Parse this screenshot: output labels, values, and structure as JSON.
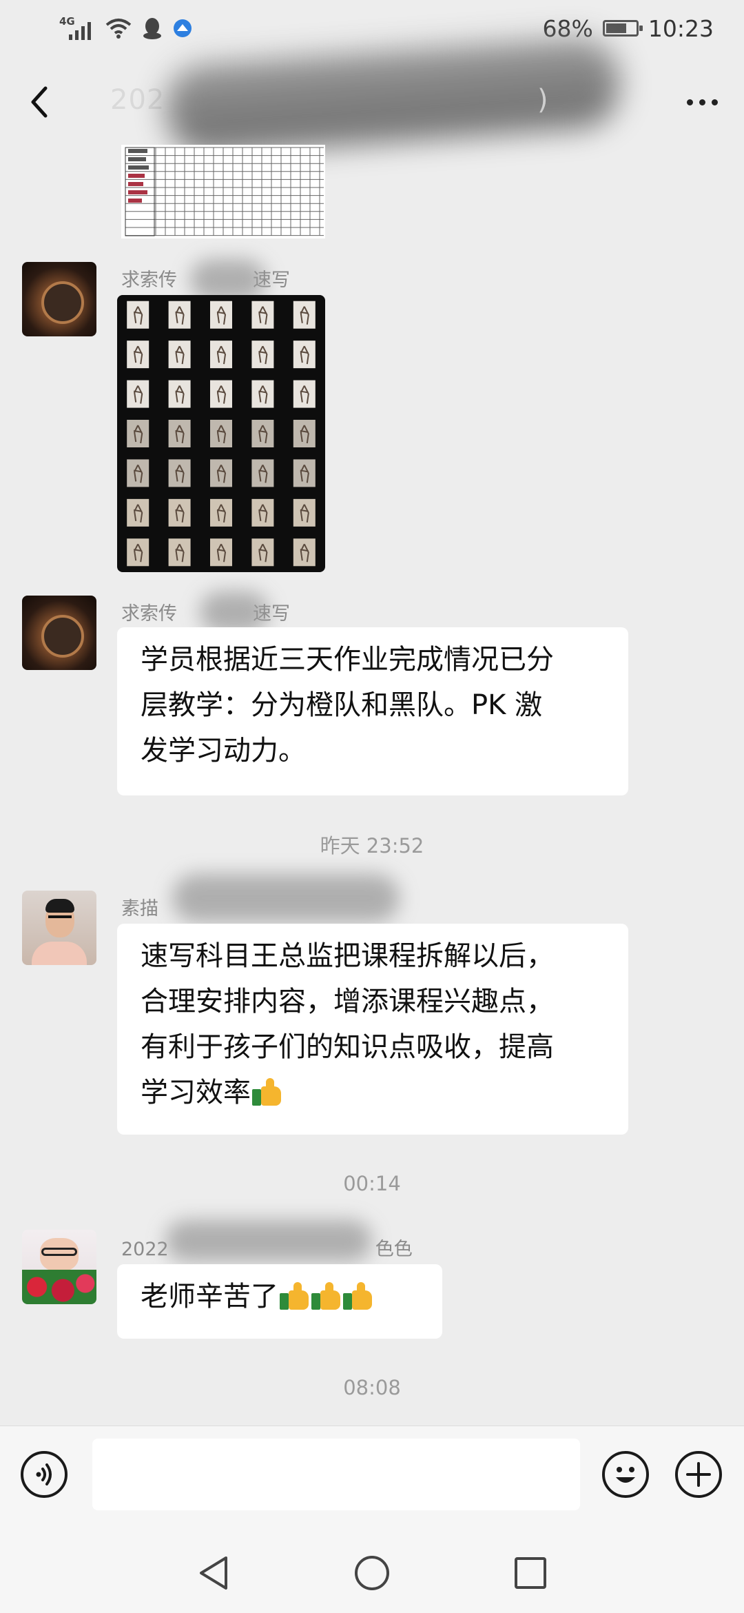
{
  "status_bar": {
    "network": "4G",
    "battery_percent": "68%",
    "battery_level": 0.68,
    "time": "10:23"
  },
  "header": {
    "title_prefix": "202",
    "title_suffix": ")",
    "back_icon": "back-arrow-icon",
    "more_icon": "more-dots-icon"
  },
  "messages": [
    {
      "sender": "求索传",
      "sender_suffix": "速写",
      "type": "image"
    },
    {
      "sender": "求索传",
      "sender_suffix": "速写",
      "type": "text",
      "lines": [
        "学员根据近三天作业完成情况已分",
        "层教学：分为橙队和黑队。PK 激",
        "发学习动力。"
      ]
    },
    {
      "sender": "素描",
      "type": "text",
      "lines": [
        "速写科目王总监把课程拆解以后，",
        "合理安排内容，增添课程兴趣点，",
        "有利于孩子们的知识点吸收，提高",
        "学习效率"
      ]
    },
    {
      "sender": "2022",
      "sender_suffix": "色色",
      "type": "text",
      "text": "老师辛苦了"
    }
  ],
  "timestamps": [
    "昨天 23:52",
    "00:14",
    "08:08"
  ],
  "input_bar": {
    "voice_icon": "voice-icon",
    "emoji_icon": "emoji-icon",
    "plus_icon": "plus-icon"
  },
  "nav_bar": {
    "back_icon": "nav-back-icon",
    "home_icon": "nav-home-icon",
    "recents_icon": "nav-recents-icon"
  }
}
